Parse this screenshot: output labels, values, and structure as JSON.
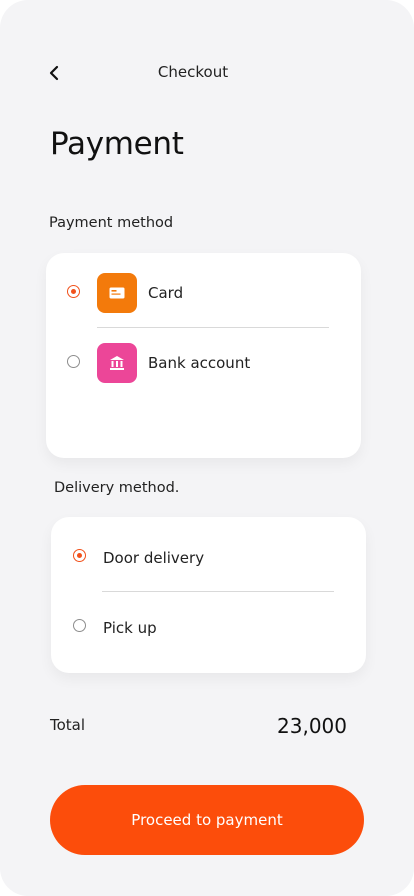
{
  "header": {
    "title": "Checkout",
    "back_icon": "chevron-left-icon"
  },
  "page_title": "Payment",
  "payment": {
    "label": "Payment method",
    "selected": "card",
    "options": [
      {
        "label": "Card",
        "icon": "card-icon",
        "color": "#f37a0b",
        "selected": true
      },
      {
        "label": "Bank account",
        "icon": "bank-icon",
        "color": "#ec4698",
        "selected": false
      }
    ]
  },
  "delivery": {
    "label": "Delivery method.",
    "options": [
      {
        "label": "Door delivery",
        "selected": true
      },
      {
        "label": "Pick up",
        "selected": false
      }
    ]
  },
  "total": {
    "label": "Total",
    "value": "23,000"
  },
  "cta": {
    "label": "Proceed to payment",
    "color": "#fc4d0b"
  },
  "accent": "#f1511b"
}
